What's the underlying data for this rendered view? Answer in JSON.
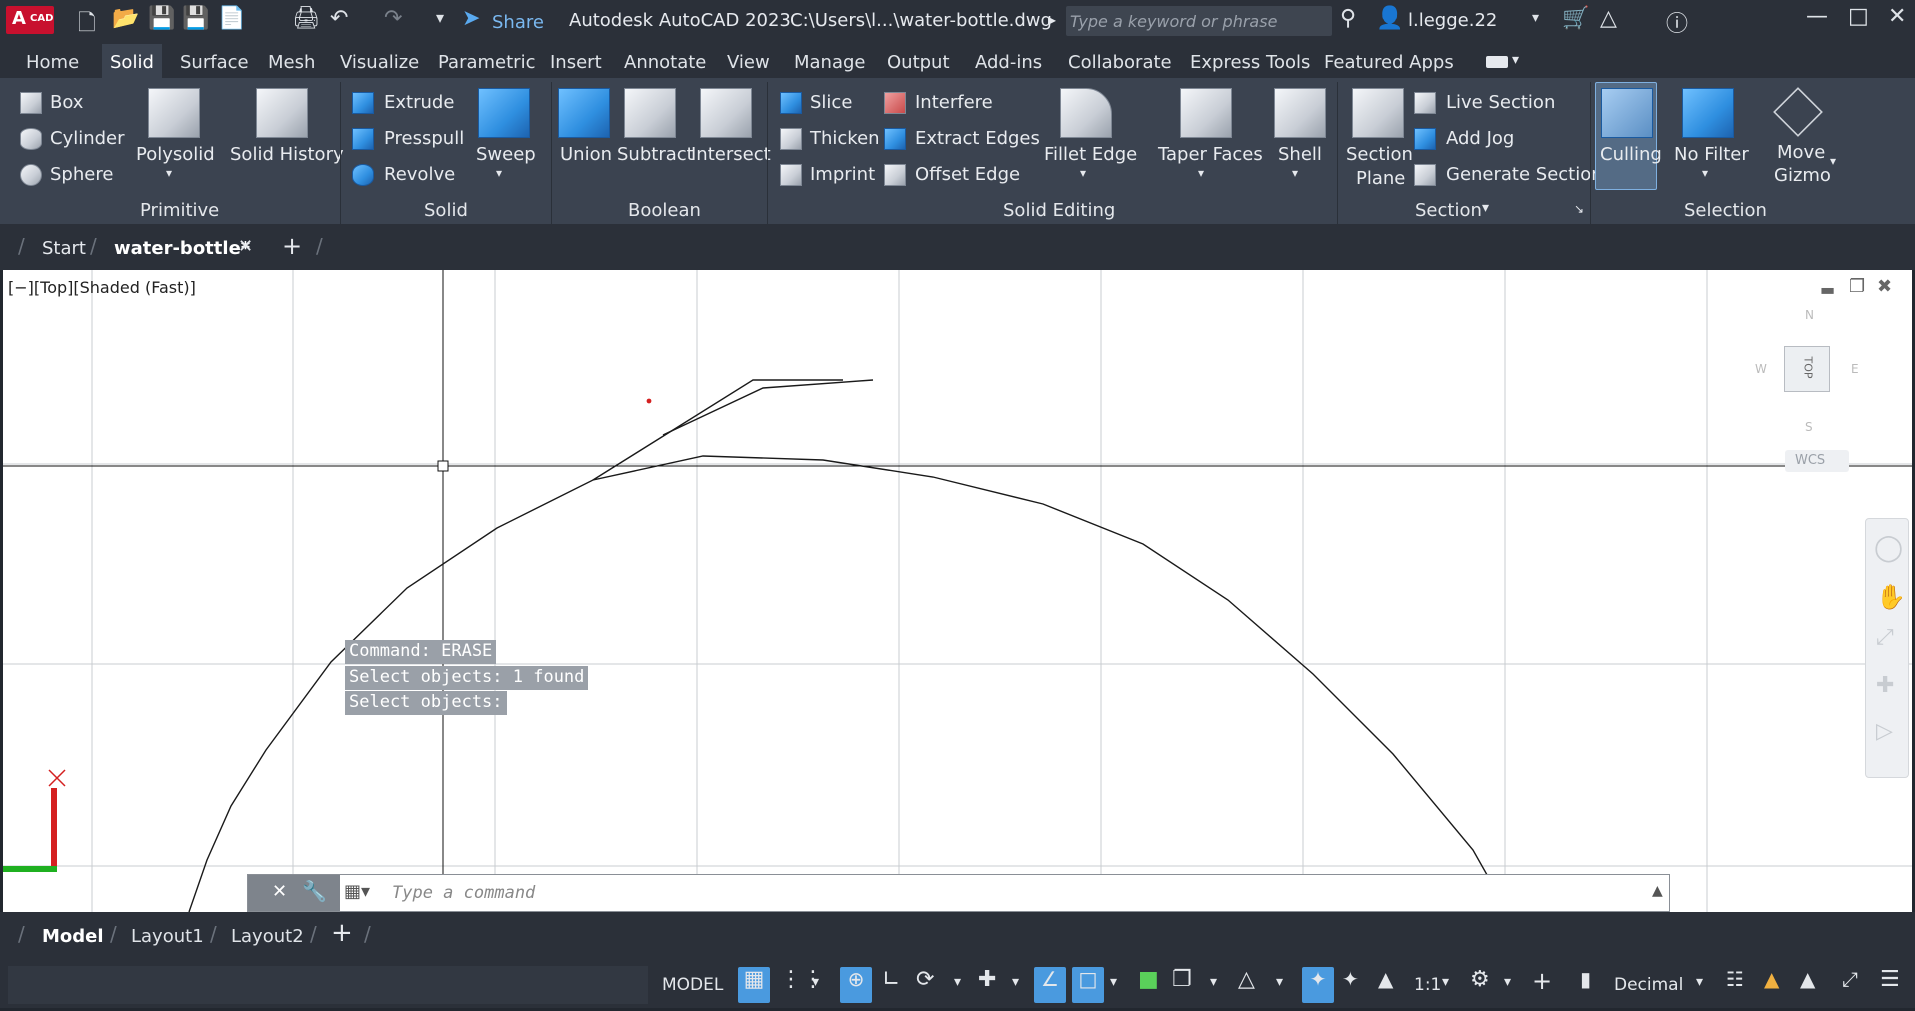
{
  "titlebar": {
    "app_badge": "A",
    "app_badge_sub": "CAD",
    "share": "Share",
    "title": "Autodesk AutoCAD 2023",
    "filepath": "C:\\Users\\l...\\water-bottle.dwg",
    "search_placeholder": "Type a keyword or phrase",
    "user": "l.legge.22"
  },
  "ribbon_tabs": [
    "Home",
    "Solid",
    "Surface",
    "Mesh",
    "Visualize",
    "Parametric",
    "Insert",
    "Annotate",
    "View",
    "Manage",
    "Output",
    "Add-ins",
    "Collaborate",
    "Express Tools",
    "Featured Apps"
  ],
  "active_tab": "Solid",
  "ribbon": {
    "primitive": {
      "box": "Box",
      "cylinder": "Cylinder",
      "sphere": "Sphere",
      "polysolid": "Polysolid",
      "solid_history": "Solid History",
      "panel": "Primitive"
    },
    "solid": {
      "extrude": "Extrude",
      "presspull": "Presspull",
      "revolve": "Revolve",
      "sweep": "Sweep",
      "panel": "Solid"
    },
    "boolean": {
      "union": "Union",
      "subtract": "Subtract",
      "intersect": "Intersect",
      "panel": "Boolean"
    },
    "solid_editing": {
      "slice": "Slice",
      "thicken": "Thicken",
      "imprint": "Imprint",
      "interfere": "Interfere",
      "extract_edges": "Extract Edges",
      "offset_edge": "Offset Edge",
      "fillet_edge": "Fillet Edge",
      "taper_faces": "Taper Faces",
      "shell": "Shell",
      "panel": "Solid Editing"
    },
    "section": {
      "section_plane_1": "Section",
      "section_plane_2": "Plane",
      "live_section": "Live Section",
      "add_jog": "Add Jog",
      "generate_section": "Generate Section",
      "panel": "Section"
    },
    "selection": {
      "culling": "Culling",
      "no_filter": "No Filter",
      "move_gizmo_1": "Move",
      "move_gizmo_2": "Gizmo",
      "panel": "Selection"
    }
  },
  "doc_tabs": {
    "start": "Start",
    "active": "water-bottle*"
  },
  "viewport": {
    "label": "[−][Top][Shaded (Fast)]",
    "viewcube_top": "TOP",
    "wcs": "WCS",
    "compass_n": "N",
    "compass_s": "S",
    "compass_e": "E",
    "compass_w": "W"
  },
  "command": {
    "history": [
      "Command: ERASE",
      "Select objects: 1 found",
      "Select objects:"
    ],
    "placeholder": "Type a command"
  },
  "layout_tabs": [
    "Model",
    "Layout1",
    "Layout2"
  ],
  "status": {
    "model": "MODEL",
    "scale": "1:1",
    "units": "Decimal"
  },
  "colors": {
    "accent": "#4a9adf",
    "ribbon_bg": "#3b4350",
    "dark_bg": "#2b3039",
    "autocad_red": "#c8102e"
  }
}
